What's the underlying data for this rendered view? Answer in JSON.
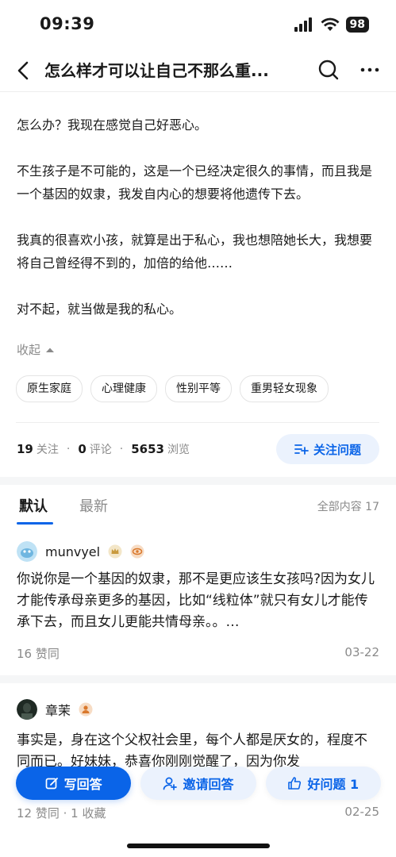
{
  "status_bar": {
    "time": "09:39",
    "battery": "98"
  },
  "nav": {
    "title": "怎么样才可以让自己不那么重..."
  },
  "question": {
    "paragraphs": [
      "怎么办？我现在感觉自己好恶心。",
      "不生孩子是不可能的，这是一个已经决定很久的事情，而且我是一个基因的奴隶，我发自内心的想要将他遗传下去。",
      "我真的很喜欢小孩，就算是出于私心，我也想陪她长大，我想要将自己曾经得不到的，加倍的给他……",
      "对不起，就当做是我的私心。"
    ],
    "collapse_label": "收起",
    "tags": [
      "原生家庭",
      "心理健康",
      "性别平等",
      "重男轻女现象"
    ],
    "stats": {
      "followers_count": "19",
      "followers_label": "关注",
      "comments_count": "0",
      "comments_label": "评论",
      "views_count": "5653",
      "views_label": "浏览",
      "separator": "·"
    },
    "follow_button": "关注问题"
  },
  "sort": {
    "default_tab": "默认",
    "latest_tab": "最新",
    "total": "全部内容 17"
  },
  "answers": [
    {
      "author": "munvyel",
      "text": "你说你是一个基因的奴隶，那不是更应该生女孩吗?因为女儿才能传承母亲更多的基因，比如“线粒体”就只有女儿才能传承下去，而且女儿更能共情母亲。。…",
      "meta": "16 赞同",
      "date": "03-22"
    },
    {
      "author": "章茉",
      "text": "事实是，身在这个父权社会里，每个人都是厌女的，程度不同而已。好妹妹，恭喜你刚刚觉醒了，因为你发",
      "meta": "12 赞同 · 1 收藏",
      "date": "02-25"
    }
  ],
  "bottom_bar": {
    "write": "写回答",
    "invite": "邀请回答",
    "good": "好问题 1"
  },
  "colors": {
    "accent": "#0a64e8",
    "accent_light": "#ebf2fd",
    "muted": "#8a8a8a"
  }
}
